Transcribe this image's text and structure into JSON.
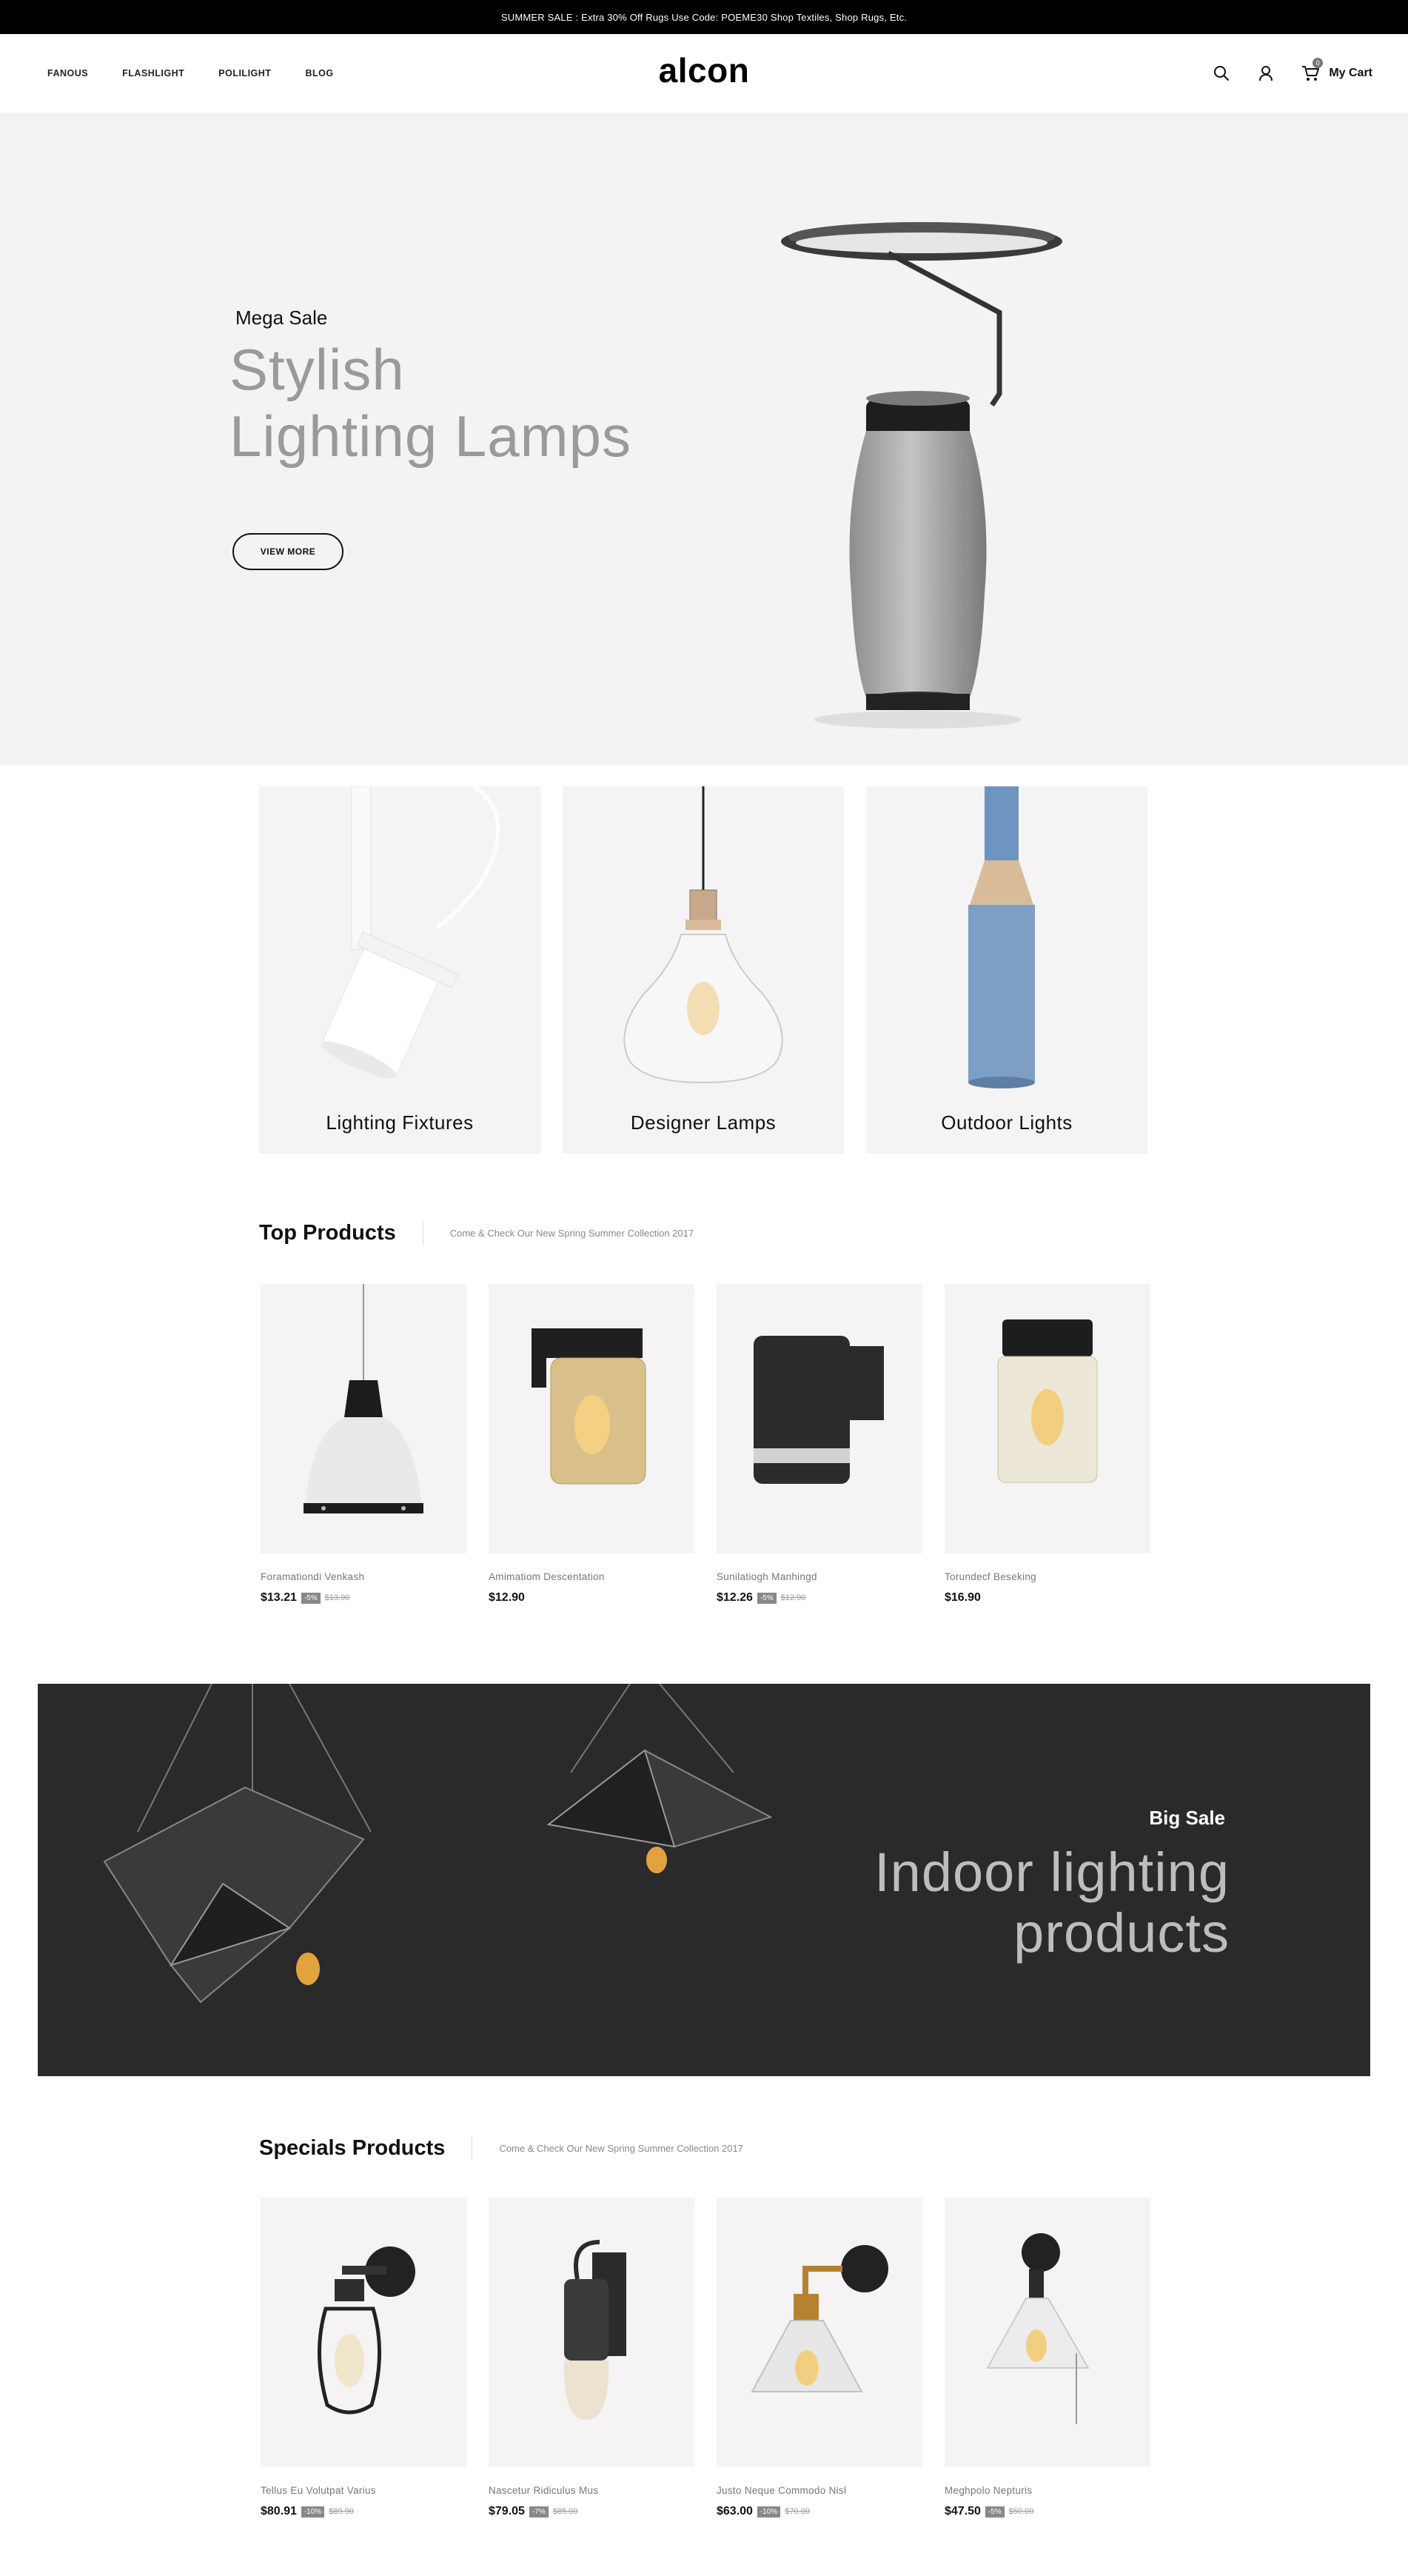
{
  "promo": {
    "text": "SUMMER SALE : Extra 30% Off Rugs Use Code: POEME30 Shop Textiles, Shop Rugs, Etc."
  },
  "header": {
    "nav": [
      "FANOUS",
      "FLASHLIGHT",
      "POLILIGHT",
      "BLOG"
    ],
    "logo": "alcon",
    "cart_count": "0",
    "cart_label": "My Cart",
    "icons": [
      "search-icon",
      "user-icon",
      "cart-icon"
    ]
  },
  "hero": {
    "eyebrow": "Mega Sale",
    "title_line1": "Stylish",
    "title_line2": "Lighting Lamps",
    "button": "VIEW MORE"
  },
  "categories": [
    {
      "label": "Lighting Fixtures"
    },
    {
      "label": "Designer Lamps"
    },
    {
      "label": "Outdoor Lights"
    }
  ],
  "top_products": {
    "title": "Top Products",
    "subtitle": "Come & Check Our New Spring Summer Collection 2017",
    "items": [
      {
        "name": "Foramationdi Venkash",
        "price": "$13.21",
        "discount": "-5%",
        "old_price": "$13.90"
      },
      {
        "name": "Amimatiom Descentation",
        "price": "$12.90",
        "discount": "",
        "old_price": ""
      },
      {
        "name": "Sunilatiogh Manhingd",
        "price": "$12.26",
        "discount": "-5%",
        "old_price": "$12.90"
      },
      {
        "name": "Torundecf Beseking",
        "price": "$16.90",
        "discount": "",
        "old_price": ""
      }
    ]
  },
  "banner": {
    "eyebrow": "Big Sale",
    "title_line1": "Indoor lighting",
    "title_line2": "products"
  },
  "specials": {
    "title": "Specials Products",
    "subtitle": "Come & Check Our New Spring Summer Collection 2017",
    "items": [
      {
        "name": "Tellus Eu Volutpat Varius",
        "price": "$80.91",
        "discount": "-10%",
        "old_price": "$89.90"
      },
      {
        "name": "Nascetur Ridiculus Mus",
        "price": "$79.05",
        "discount": "-7%",
        "old_price": "$85.00"
      },
      {
        "name": "Justo Neque Commodo Nisl",
        "price": "$63.00",
        "discount": "-10%",
        "old_price": "$70.00"
      },
      {
        "name": "Meghpolo Nepturis",
        "price": "$47.50",
        "discount": "-5%",
        "old_price": "$50.00"
      }
    ]
  },
  "colors": {
    "promo_bg": "#000000",
    "hero_bg": "#f3f3f3",
    "card_bg": "#f5f3f3",
    "banner_bg": "#2a2a2a",
    "text": "#111111",
    "muted": "#888888"
  }
}
